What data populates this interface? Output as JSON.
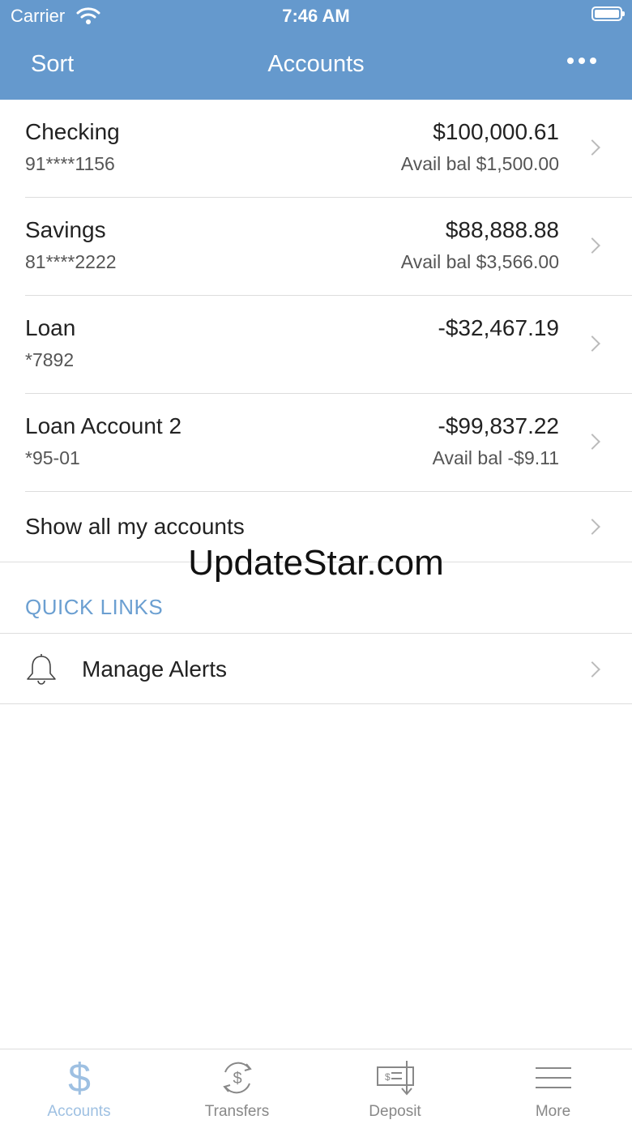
{
  "status_bar": {
    "carrier": "Carrier",
    "time": "7:46 AM",
    "wifi_icon": "wifi-icon",
    "battery_icon": "battery-icon"
  },
  "nav": {
    "left_label": "Sort",
    "title": "Accounts",
    "more_icon": "more-ellipsis-icon"
  },
  "accounts": [
    {
      "name": "Checking",
      "number": "91****1156",
      "balance": "$100,000.61",
      "available": "Avail bal $1,500.00"
    },
    {
      "name": "Savings",
      "number": "81****2222",
      "balance": "$88,888.88",
      "available": "Avail bal $3,566.00"
    },
    {
      "name": "Loan",
      "number": "*7892",
      "balance": "-$32,467.19",
      "available": ""
    },
    {
      "name": "Loan Account 2",
      "number": "*95-01",
      "balance": "-$99,837.22",
      "available": "Avail bal -$9.11"
    }
  ],
  "show_all_label": "Show all my accounts",
  "watermark": "UpdateStar.com",
  "quick_links": {
    "title": "QUICK LINKS",
    "items": [
      {
        "label": "Manage Alerts",
        "icon": "bell-icon"
      }
    ]
  },
  "tabs": [
    {
      "label": "Accounts",
      "icon": "dollar-icon",
      "active": true
    },
    {
      "label": "Transfers",
      "icon": "transfer-icon",
      "active": false
    },
    {
      "label": "Deposit",
      "icon": "check-deposit-icon",
      "active": false
    },
    {
      "label": "More",
      "icon": "menu-icon",
      "active": false
    }
  ],
  "colors": {
    "header": "#6599cd",
    "accent": "#6b9fd1",
    "tab_active": "#9ec0e2",
    "tab_inactive": "#888888"
  }
}
